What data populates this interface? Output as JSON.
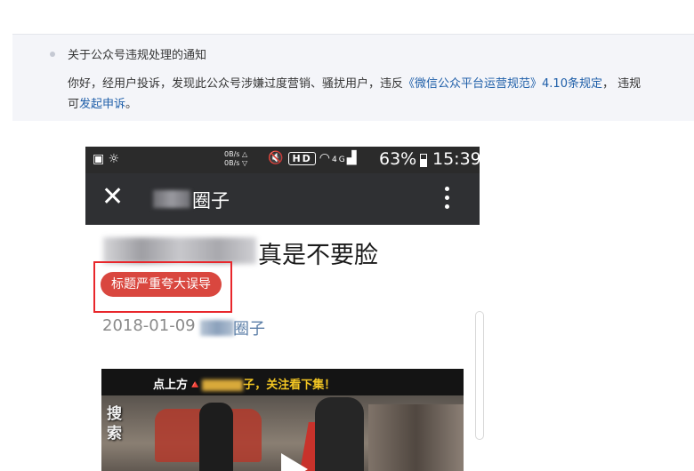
{
  "notice": {
    "title": "关于公众号违规处理的通知",
    "line1_prefix": "你好，经用户投诉，发现此公众号涉嫌过度营销、骚扰用户，违反",
    "line1_link": "《微信公众平台运营规范》4.10条规定",
    "line1_suffix": "， 违规",
    "line2_prefix": "可",
    "line2_link": "发起申诉",
    "line2_suffix": "。"
  },
  "statusbar": {
    "net_up": "0B/s △",
    "net_down": "0B/s ▽",
    "hd_label": "HD",
    "signal_label": "4G",
    "battery": "63%",
    "time": "15:39"
  },
  "appbar": {
    "close_glyph": "✕",
    "account_suffix": "圈子"
  },
  "article": {
    "headline_suffix": "真是不要脸",
    "tag_label": "标题严重夸大误导",
    "date": "2018-01-09",
    "account_suffix": "圈子"
  },
  "video": {
    "caption_prefix": "点上方🔺",
    "caption_suffix": "子，关注看下集！",
    "side_text": "搜索"
  },
  "colors": {
    "link": "#1f5fa9",
    "tag_bg": "#d9473f",
    "highlight_border": "#e8262b",
    "appbar_bg": "#2f3033"
  }
}
